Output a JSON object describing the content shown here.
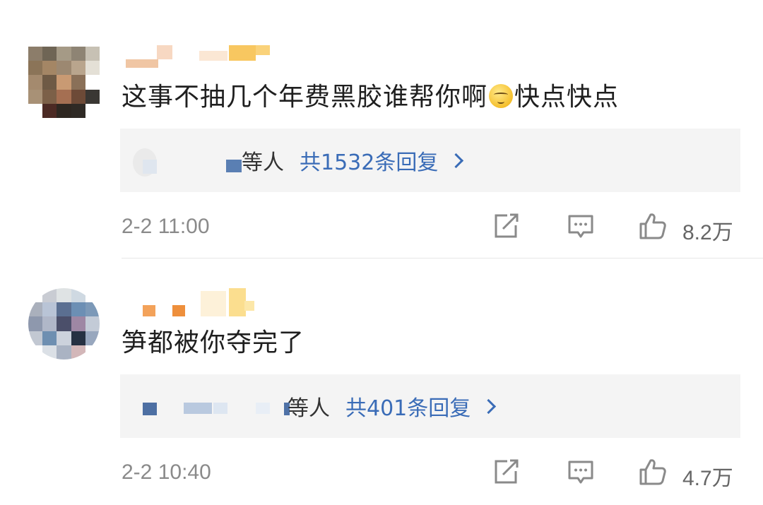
{
  "comments": [
    {
      "text_before_emoji": "这事不抽几个年费黑胶谁帮你啊",
      "emoji_icon": "sleepy-face-emoji-icon",
      "text_after_emoji": "快点快点",
      "reply_names": "等人",
      "reply_count": "共1532条回复",
      "timestamp": "2-2 11:00",
      "like_count": "8.2万"
    },
    {
      "text_before_emoji": "笋都被你夺完了",
      "reply_names": "等人",
      "reply_count": "共401条回复",
      "timestamp": "2-2 10:40",
      "like_count": "4.7万"
    }
  ],
  "colors": {
    "reply_link": "#3a6cb7",
    "reply_box_bg": "#f4f4f4",
    "text_primary": "#1f1f1f",
    "text_secondary": "#8a8a8a"
  },
  "icons": [
    "share-icon",
    "reply-comment-icon",
    "thumbs-up-icon",
    "chevron-right-icon"
  ]
}
